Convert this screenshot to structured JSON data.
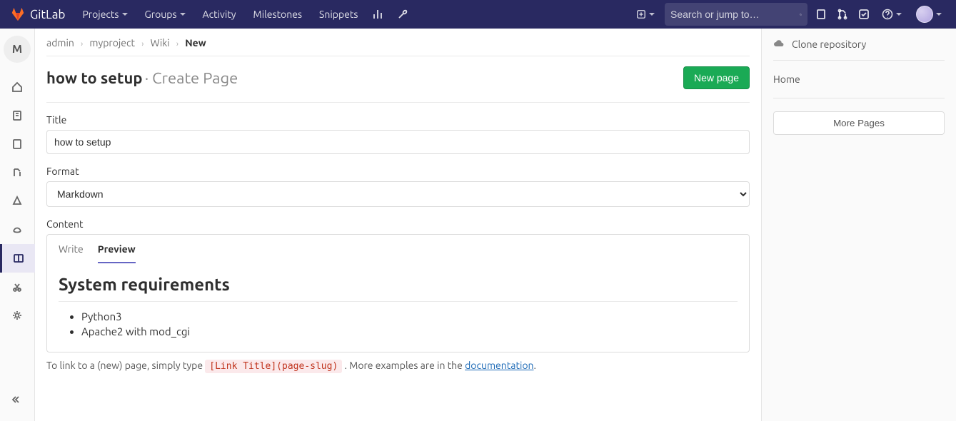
{
  "header": {
    "brand": "GitLab",
    "nav": [
      {
        "label": "Projects",
        "dropdown": true
      },
      {
        "label": "Groups",
        "dropdown": true
      },
      {
        "label": "Activity",
        "dropdown": false
      },
      {
        "label": "Milestones",
        "dropdown": false
      },
      {
        "label": "Snippets",
        "dropdown": false
      }
    ],
    "search_placeholder": "Search or jump to…"
  },
  "sidebar": {
    "project_letter": "M"
  },
  "breadcrumb": {
    "items": [
      "admin",
      "myproject",
      "Wiki"
    ],
    "current": "New"
  },
  "page": {
    "title": "how to setup",
    "subtitle": "· Create Page",
    "new_button": "New page"
  },
  "form": {
    "title_label": "Title",
    "title_value": "how to setup",
    "format_label": "Format",
    "format_value": "Markdown",
    "content_label": "Content",
    "tabs": {
      "write": "Write",
      "preview": "Preview"
    },
    "preview": {
      "heading": "System requirements",
      "items": [
        "Python3",
        "Apache2 with mod_cgi"
      ]
    },
    "hint_prefix": "To link to a (new) page, simply type ",
    "hint_code": "[Link Title](page-slug)",
    "hint_mid": ". More examples are in the ",
    "hint_link": "documentation",
    "hint_suffix": "."
  },
  "rightbar": {
    "clone": "Clone repository",
    "home": "Home",
    "more": "More Pages"
  }
}
